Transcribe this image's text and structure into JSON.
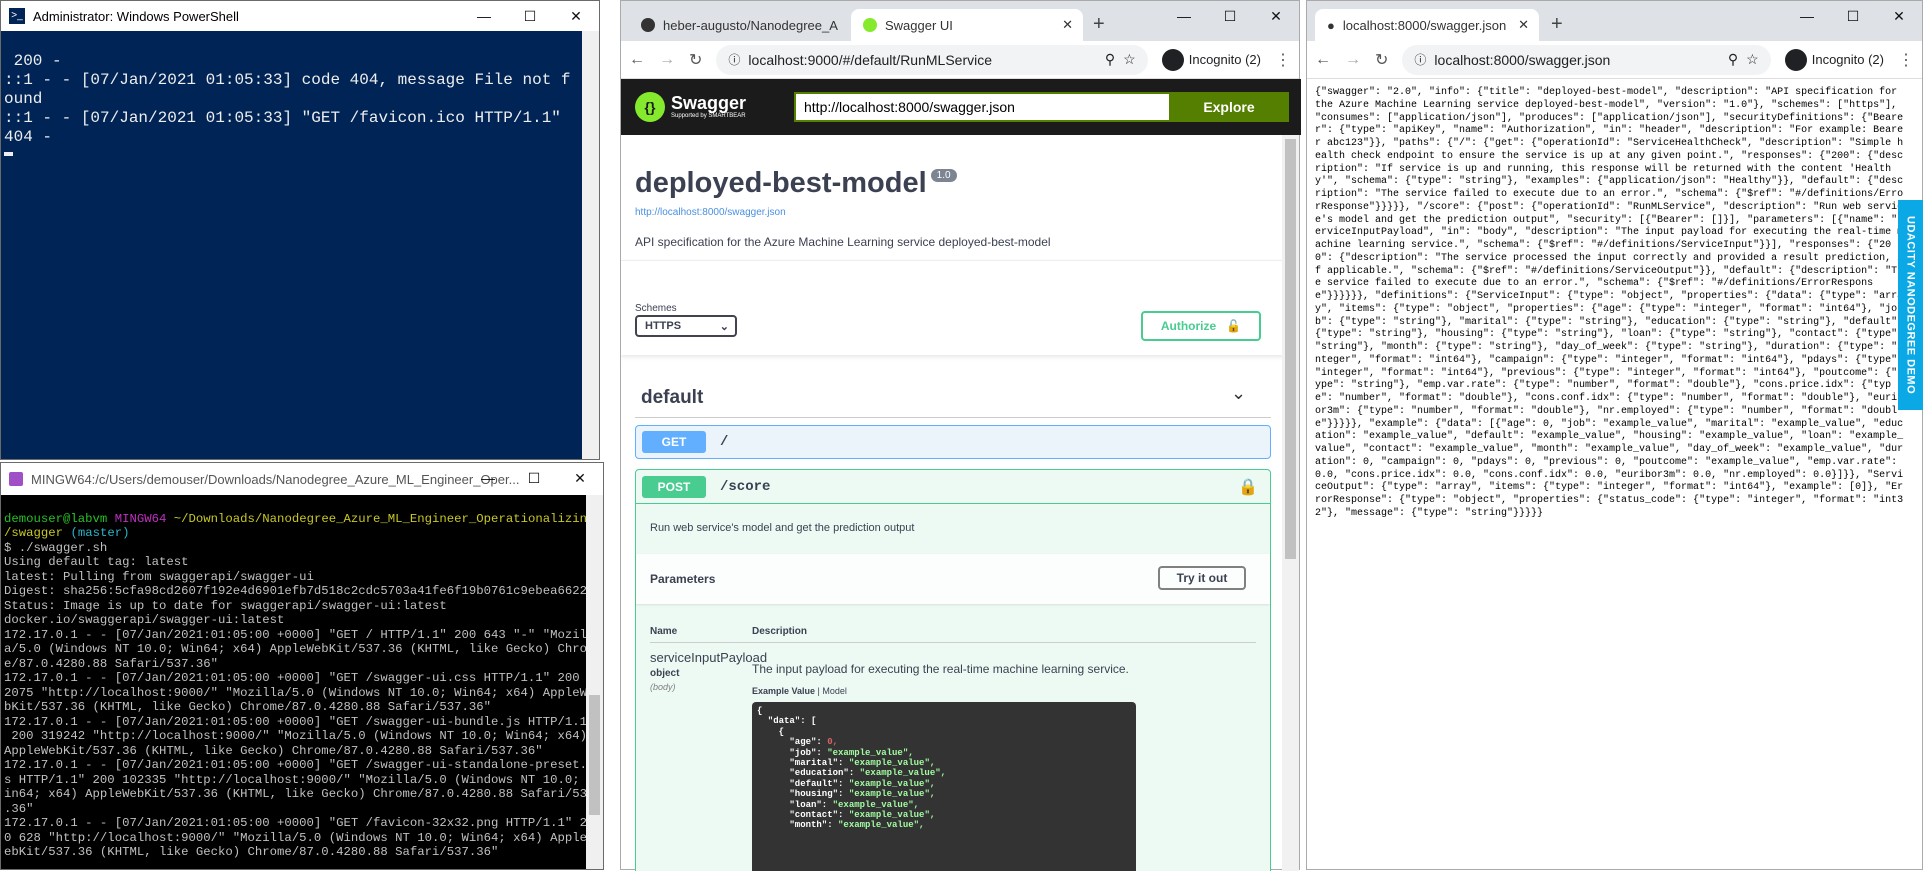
{
  "powershell": {
    "title": "Administrator: Windows PowerShell",
    "lines": [
      " 200 -",
      "::1 - - [07/Jan/2021 01:05:33] code 404, message File not f",
      "ound",
      "::1 - - [07/Jan/2021 01:05:33] \"GET /favicon.ico HTTP/1.1\"",
      "404 -"
    ]
  },
  "mingw": {
    "title": "MINGW64:/c/Users/demouser/Downloads/Nanodegree_Azure_ML_Engineer_Oper...",
    "prompt_user": "demouser@labvm",
    "prompt_host": "MINGW64",
    "prompt_path": "~/Downloads/Nanodegree_Azure_ML_Engineer_Operationalizing",
    "prompt_path2": "/swagger",
    "prompt_branch": "(master)",
    "lines": [
      "$ ./swagger.sh",
      "Using default tag: latest",
      "latest: Pulling from swaggerapi/swagger-ui",
      "Digest: sha256:5cfa98cd2607f192e4d6901efb7d518c2cdc5703a41fe6f19b0761c9ebea6622",
      "Status: Image is up to date for swaggerapi/swagger-ui:latest",
      "docker.io/swaggerapi/swagger-ui:latest",
      "172.17.0.1 - - [07/Jan/2021:01:05:00 +0000] \"GET / HTTP/1.1\" 200 643 \"-\" \"Mozill",
      "a/5.0 (Windows NT 10.0; Win64; x64) AppleWebKit/537.36 (KHTML, like Gecko) Chrom",
      "e/87.0.4280.88 Safari/537.36\"",
      "172.17.0.1 - - [07/Jan/2021:01:05:00 +0000] \"GET /swagger-ui.css HTTP/1.1\" 200 2",
      "2075 \"http://localhost:9000/\" \"Mozilla/5.0 (Windows NT 10.0; Win64; x64) AppleWe",
      "bKit/537.36 (KHTML, like Gecko) Chrome/87.0.4280.88 Safari/537.36\"",
      "172.17.0.1 - - [07/Jan/2021:01:05:00 +0000] \"GET /swagger-ui-bundle.js HTTP/1.1\"",
      " 200 319242 \"http://localhost:9000/\" \"Mozilla/5.0 (Windows NT 10.0; Win64; x64)",
      "AppleWebKit/537.36 (KHTML, like Gecko) Chrome/87.0.4280.88 Safari/537.36\"",
      "172.17.0.1 - - [07/Jan/2021:01:05:00 +0000] \"GET /swagger-ui-standalone-preset.j",
      "s HTTP/1.1\" 200 102335 \"http://localhost:9000/\" \"Mozilla/5.0 (Windows NT 10.0; W",
      "in64; x64) AppleWebKit/537.36 (KHTML, like Gecko) Chrome/87.0.4280.88 Safari/537",
      ".36\"",
      "172.17.0.1 - - [07/Jan/2021:01:05:00 +0000] \"GET /favicon-32x32.png HTTP/1.1\" 20",
      "0 628 \"http://localhost:9000/\" \"Mozilla/5.0 (Windows NT 10.0; Win64; x64) AppleW",
      "ebKit/537.36 (KHTML, like Gecko) Chrome/87.0.4280.88 Safari/537.36\""
    ]
  },
  "swagger_browser": {
    "tab1": "heber-augusto/Nanodegree_A",
    "tab2": "Swagger UI",
    "url": "localhost:9000/#/default/RunMLService",
    "incognito": "Incognito (2)",
    "logo_text": "Swagger",
    "logo_sub": "Supported by SMARTBEAR",
    "spec_url": "http://localhost:8000/swagger.json",
    "explore": "Explore",
    "title": "deployed-best-model",
    "version": "1.0",
    "link": "http://localhost:8000/swagger.json",
    "description": "API specification for the Azure Machine Learning service deployed-best-model",
    "schemes_label": "Schemes",
    "scheme": "HTTPS",
    "authorize": "Authorize",
    "section": "default",
    "get_method": "GET",
    "get_path": "/",
    "post_method": "POST",
    "post_path": "/score",
    "post_summary": "Run web service's model and get the prediction output",
    "parameters": "Parameters",
    "try_it": "Try it out",
    "col_name": "Name",
    "col_desc": "Description",
    "param_name": "serviceInputPayload",
    "param_type": "object",
    "param_in": "(body)",
    "param_desc": "The input payload for executing the real-time machine learning service.",
    "example_value": "Example Value",
    "model": "Model",
    "code": [
      [
        "{",
        ""
      ],
      [
        "  \"data\": [",
        ""
      ],
      [
        "    {",
        ""
      ],
      [
        "      \"age\": ",
        "0,"
      ],
      [
        "      \"job\": ",
        "\"example_value\","
      ],
      [
        "      \"marital\": ",
        "\"example_value\","
      ],
      [
        "      \"education\": ",
        "\"example_value\","
      ],
      [
        "      \"default\": ",
        "\"example_value\","
      ],
      [
        "      \"housing\": ",
        "\"example_value\","
      ],
      [
        "      \"loan\": ",
        "\"example_value\","
      ],
      [
        "      \"contact\": ",
        "\"example_value\","
      ],
      [
        "      \"month\": ",
        "\"example_value\","
      ]
    ]
  },
  "json_browser": {
    "tab": "localhost:8000/swagger.json",
    "url": "localhost:8000/swagger.json",
    "incognito": "Incognito (2)",
    "content": "{\"swagger\": \"2.0\", \"info\": {\"title\": \"deployed-best-model\", \"description\": \"API specification for the Azure Machine Learning service deployed-best-model\", \"version\": \"1.0\"}, \"schemes\": [\"https\"], \"consumes\": [\"application/json\"], \"produces\": [\"application/json\"], \"securityDefinitions\": {\"Bearer\": {\"type\": \"apiKey\", \"name\": \"Authorization\", \"in\": \"header\", \"description\": \"For example: Bearer abc123\"}}, \"paths\": {\"/\": {\"get\": {\"operationId\": \"ServiceHealthCheck\", \"description\": \"Simple health check endpoint to ensure the service is up at any given point.\", \"responses\": {\"200\": {\"description\": \"If service is up and running, this response will be returned with the content 'Healthy'\", \"schema\": {\"type\": \"string\"}, \"examples\": {\"application/json\": \"Healthy\"}}, \"default\": {\"description\": \"The service failed to execute due to an error.\", \"schema\": {\"$ref\": \"#/definitions/ErrorResponse\"}}}}}, \"/score\": {\"post\": {\"operationId\": \"RunMLService\", \"description\": \"Run web service's model and get the prediction output\", \"security\": [{\"Bearer\": []}], \"parameters\": [{\"name\": \"serviceInputPayload\", \"in\": \"body\", \"description\": \"The input payload for executing the real-time machine learning service.\", \"schema\": {\"$ref\": \"#/definitions/ServiceInput\"}}], \"responses\": {\"200\": {\"description\": \"The service processed the input correctly and provided a result prediction, if applicable.\", \"schema\": {\"$ref\": \"#/definitions/ServiceOutput\"}}, \"default\": {\"description\": \"The service failed to execute due to an error.\", \"schema\": {\"$ref\": \"#/definitions/ErrorResponse\"}}}}}}, \"definitions\": {\"ServiceInput\": {\"type\": \"object\", \"properties\": {\"data\": {\"type\": \"array\", \"items\": {\"type\": \"object\", \"properties\": {\"age\": {\"type\": \"integer\", \"format\": \"int64\"}, \"job\": {\"type\": \"string\"}, \"marital\": {\"type\": \"string\"}, \"education\": {\"type\": \"string\"}, \"default\": {\"type\": \"string\"}, \"housing\": {\"type\": \"string\"}, \"loan\": {\"type\": \"string\"}, \"contact\": {\"type\": \"string\"}, \"month\": {\"type\": \"string\"}, \"day_of_week\": {\"type\": \"string\"}, \"duration\": {\"type\": \"integer\", \"format\": \"int64\"}, \"campaign\": {\"type\": \"integer\", \"format\": \"int64\"}, \"pdays\": {\"type\": \"integer\", \"format\": \"int64\"}, \"previous\": {\"type\": \"integer\", \"format\": \"int64\"}, \"poutcome\": {\"type\": \"string\"}, \"emp.var.rate\": {\"type\": \"number\", \"format\": \"double\"}, \"cons.price.idx\": {\"type\": \"number\", \"format\": \"double\"}, \"cons.conf.idx\": {\"type\": \"number\", \"format\": \"double\"}, \"euribor3m\": {\"type\": \"number\", \"format\": \"double\"}, \"nr.employed\": {\"type\": \"number\", \"format\": \"double\"}}}}}, \"example\": {\"data\": [{\"age\": 0, \"job\": \"example_value\", \"marital\": \"example_value\", \"education\": \"example_value\", \"default\": \"example_value\", \"housing\": \"example_value\", \"loan\": \"example_value\", \"contact\": \"example_value\", \"month\": \"example_value\", \"day_of_week\": \"example_value\", \"duration\": 0, \"campaign\": 0, \"pdays\": 0, \"previous\": 0, \"poutcome\": \"example_value\", \"emp.var.rate\": 0.0, \"cons.price.idx\": 0.0, \"cons.conf.idx\": 0.0, \"euribor3m\": 0.0, \"nr.employed\": 0.0}]}}, \"ServiceOutput\": {\"type\": \"array\", \"items\": {\"type\": \"integer\", \"format\": \"int64\"}, \"example\": [0]}, \"ErrorResponse\": {\"type\": \"object\", \"properties\": {\"status_code\": {\"type\": \"integer\", \"format\": \"int32\"}, \"message\": {\"type\": \"string\"}}}}}"
  },
  "udacity_tab": "UDACITY NANODEGREE DEMO"
}
